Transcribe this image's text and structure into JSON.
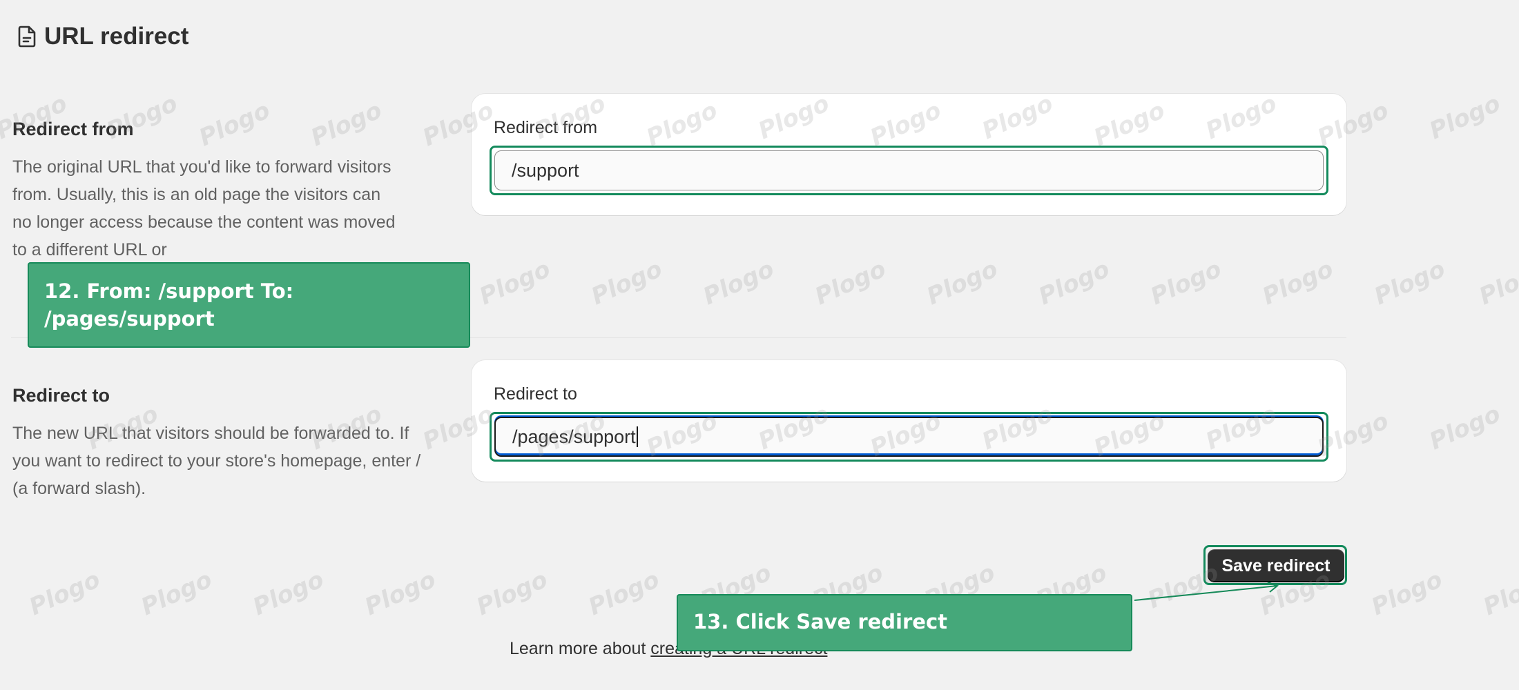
{
  "header": {
    "title": "URL redirect",
    "icon": "document-icon"
  },
  "redirect_from": {
    "section_title": "Redirect from",
    "description": "The original URL that you'd like to forward visitors from. Usually, this is an old page the visitors can no longer access because the content was moved to a different URL or",
    "field_label": "Redirect from",
    "field_value": "/support"
  },
  "redirect_to": {
    "section_title": "Redirect to",
    "description": "The new URL that visitors should be forwarded to. If you want to redirect to your store's homepage, enter / (a forward slash).",
    "field_label": "Redirect to",
    "field_value": "/pages/support"
  },
  "actions": {
    "save_label": "Save redirect"
  },
  "footer": {
    "prefix": "Learn more about ",
    "link_text": "creating a URL redirect"
  },
  "callouts": {
    "step12": "12. From: /support To: /pages/support",
    "step13": "13. Click Save redirect"
  },
  "watermark": {
    "text": "Plogo"
  },
  "colors": {
    "accent": "#45a87a",
    "highlight_border": "#138a5c",
    "primary_button": "#303030",
    "focus": "#005bd3"
  }
}
